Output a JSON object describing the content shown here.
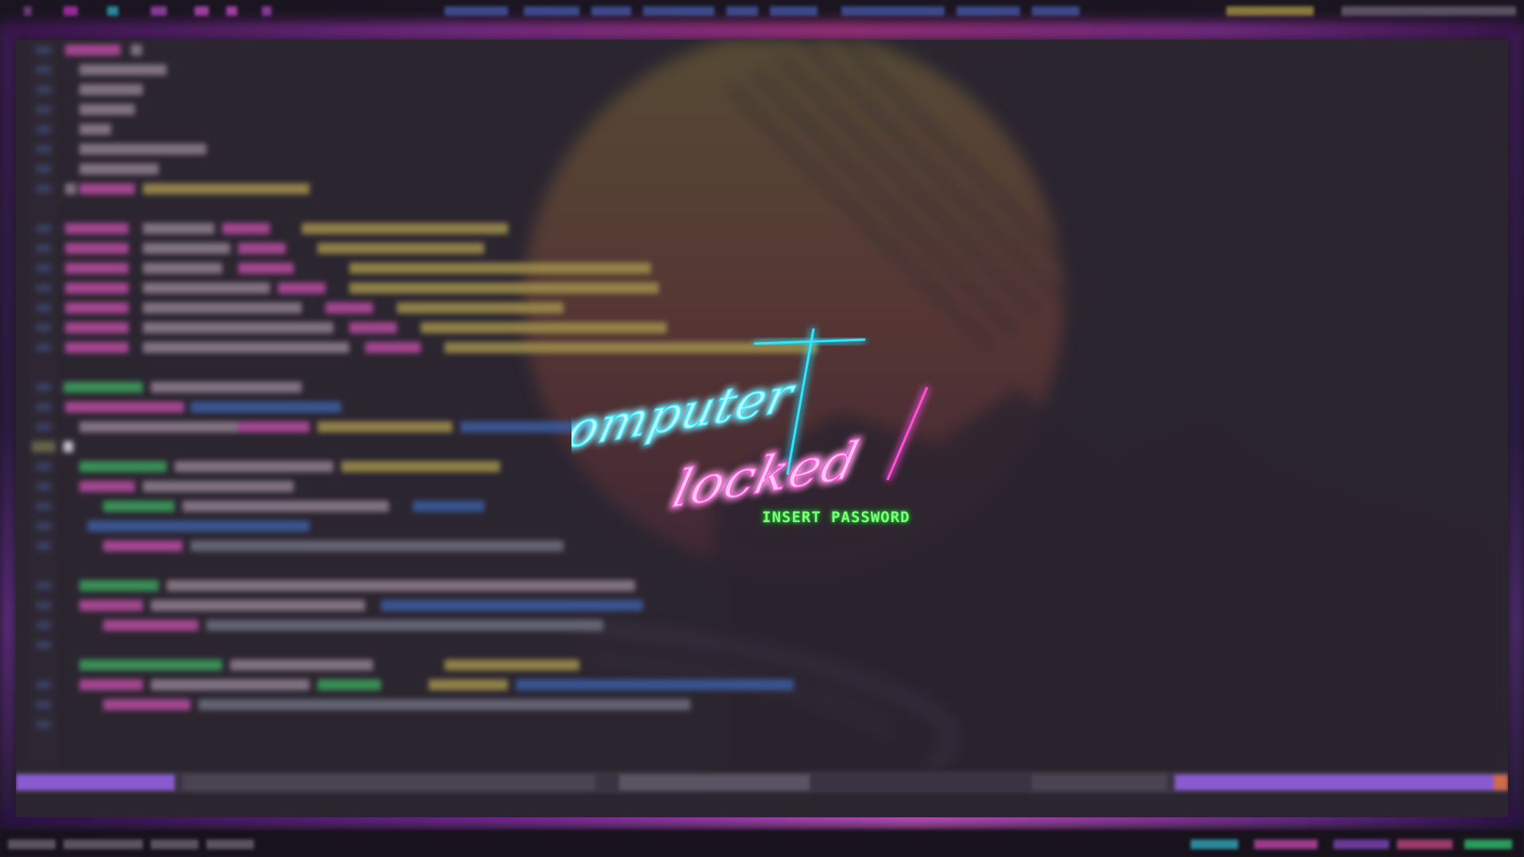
{
  "lockscreen": {
    "title_line1": "computer",
    "title_line2": "locked",
    "prompt": "INSERT PASSWORD"
  },
  "colors": {
    "title_line1": "#2fe6ff",
    "title_line2": "#ff4fd8",
    "prompt": "#7cff7a",
    "frame_glow": "#a0307f",
    "editor_bg": "#2b2530"
  },
  "icons": {
    "cursor": "text-cursor-block"
  }
}
